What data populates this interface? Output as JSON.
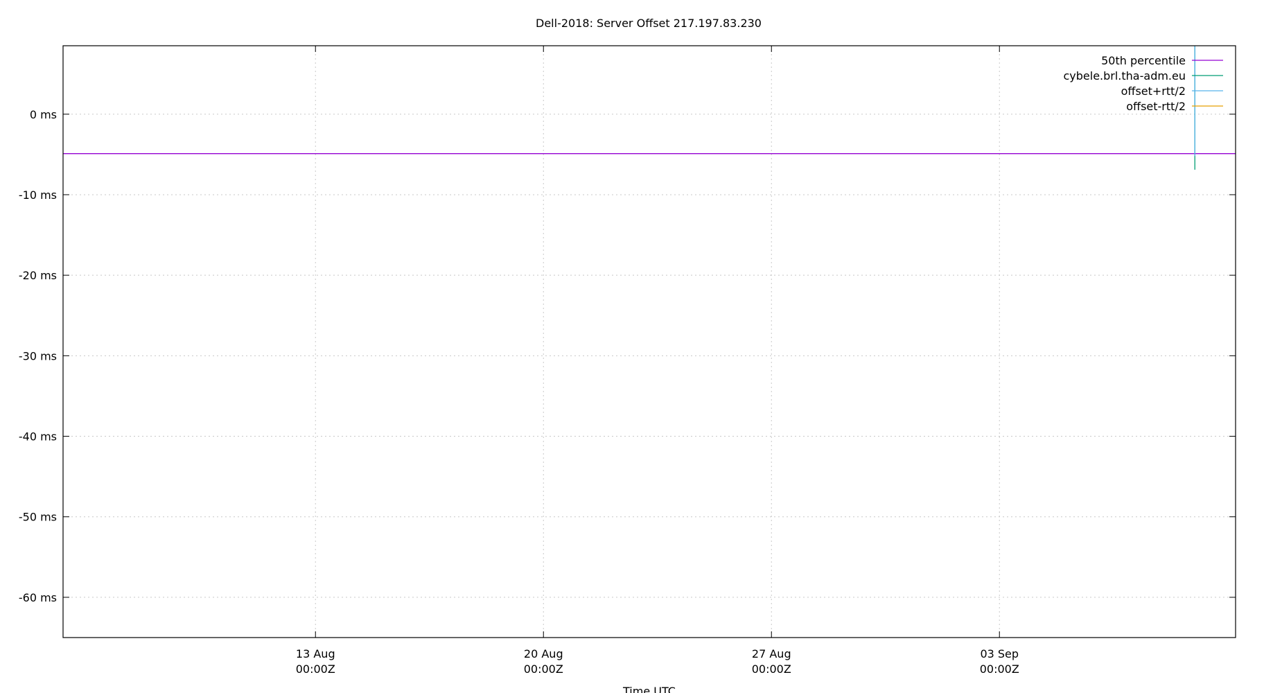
{
  "chart_data": {
    "type": "line",
    "title": "Dell-2018: Server Offset 217.197.83.230",
    "xlabel": "Time UTC",
    "ylabel": "",
    "ylim": [
      -65,
      8.5
    ],
    "xlim": [
      "2018-08-05T06:00:00Z",
      "2018-09-10T06:00:00Z"
    ],
    "y_ticks": [
      {
        "value": 0,
        "label": "0 ms"
      },
      {
        "value": -10,
        "label": "-10 ms"
      },
      {
        "value": -20,
        "label": "-20 ms"
      },
      {
        "value": -30,
        "label": "-30 ms"
      },
      {
        "value": -40,
        "label": "-40 ms"
      },
      {
        "value": -50,
        "label": "-50 ms"
      },
      {
        "value": -60,
        "label": "-60 ms"
      }
    ],
    "x_ticks": [
      {
        "value": "2018-08-13T00:00:00Z",
        "line1": "13 Aug",
        "line2": "00:00Z"
      },
      {
        "value": "2018-08-20T00:00:00Z",
        "line1": "20 Aug",
        "line2": "00:00Z"
      },
      {
        "value": "2018-08-27T00:00:00Z",
        "line1": "27 Aug",
        "line2": "00:00Z"
      },
      {
        "value": "2018-09-03T00:00:00Z",
        "line1": "03 Sep",
        "line2": "00:00Z"
      }
    ],
    "grid": true,
    "legend_position": "top-right",
    "series": [
      {
        "name": "50th percentile",
        "color": "#9400d3",
        "kind": "hline",
        "y": -4.9
      },
      {
        "name": "cybele.brl.tha-adm.eu",
        "color": "#009e73",
        "kind": "vline",
        "x": "2018-09-09T00:00:00Z",
        "y_range": [
          -6.9,
          8.5
        ]
      },
      {
        "name": "offset+rtt/2",
        "color": "#56b4e9",
        "kind": "vline",
        "x": "2018-09-09T00:00:00Z",
        "y_range": [
          -5.2,
          8.5
        ]
      },
      {
        "name": "offset-rtt/2",
        "color": "#e69f00",
        "kind": "none"
      }
    ]
  }
}
